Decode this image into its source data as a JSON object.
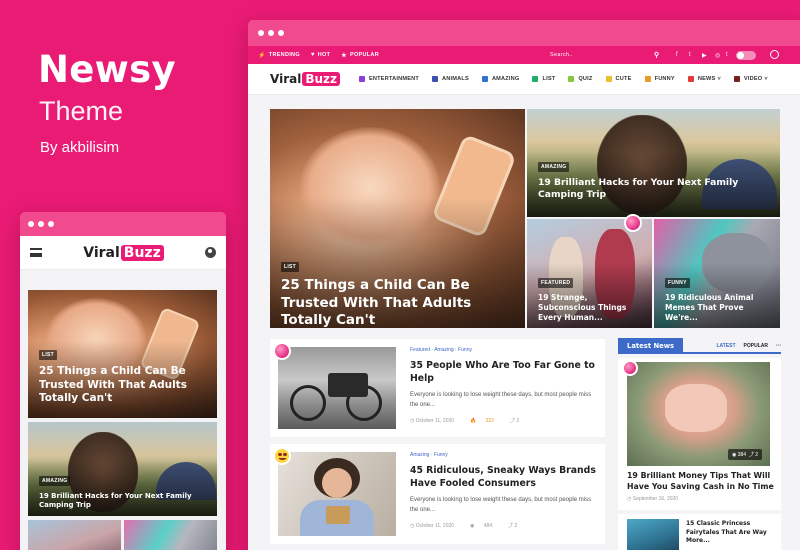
{
  "promo": {
    "title": "Newsy",
    "subtitle": "Theme",
    "author": "By akbilisim"
  },
  "brand": {
    "logo_left": "Viral",
    "logo_right": "Buzz",
    "accent": "#ea1b75",
    "blue": "#3d6ac8"
  },
  "mobile": {
    "hero": {
      "tag": "LIST",
      "title": "25 Things a Child Can Be Trusted With That Adults Totally Can't"
    },
    "second": {
      "tag": "AMAZING",
      "title": "19 Brilliant Hacks for Your Next Family Camping Trip"
    }
  },
  "topbar": {
    "items": [
      {
        "icon": "lightning-icon",
        "glyph": "⚡",
        "label": "TRENDING"
      },
      {
        "icon": "heart-icon",
        "glyph": "♥",
        "label": "HOT"
      },
      {
        "icon": "star-icon",
        "glyph": "★",
        "label": "POPULAR"
      }
    ],
    "search_placeholder": "Search..",
    "social": [
      {
        "name": "facebook-icon",
        "glyph": "f"
      },
      {
        "name": "twitter-icon",
        "glyph": "t"
      },
      {
        "name": "youtube-icon",
        "glyph": "▶"
      },
      {
        "name": "instagram-icon",
        "glyph": "◎"
      },
      {
        "name": "tumblr-icon",
        "glyph": "t"
      }
    ]
  },
  "nav": {
    "items": [
      {
        "label": "ENTERTAINMENT",
        "color": "#8a3fd6"
      },
      {
        "label": "ANIMALS",
        "color": "#3d4fb0"
      },
      {
        "label": "AMAZING",
        "color": "#2f6fd6"
      },
      {
        "label": "LIST",
        "color": "#1fae6a"
      },
      {
        "label": "QUIZ",
        "color": "#86c83a"
      },
      {
        "label": "CUTE",
        "color": "#e8c12a"
      },
      {
        "label": "FUNNY",
        "color": "#e99a26"
      },
      {
        "label": "NEWS",
        "color": "#e23a3a",
        "dropdown": "˅"
      },
      {
        "label": "VIDEO",
        "color": "#7a1d1d",
        "dropdown": "˅"
      }
    ]
  },
  "featured": {
    "main": {
      "tag": "LIST",
      "title": "25 Things a Child Can Be Trusted With That Adults Totally Can't"
    },
    "top_right": {
      "tag": "AMAZING",
      "title": "19 Brilliant Hacks for Your Next Family Camping Trip"
    },
    "bottom_left": {
      "tag": "FEATURED",
      "title": "19 Strange, Subconscious Things Every Human..."
    },
    "bottom_right": {
      "tag": "FUNNY",
      "title": "19 Ridiculous Animal Memes That Prove We're..."
    }
  },
  "posts": [
    {
      "cats": [
        "Featured",
        "Amazing",
        "Funny"
      ],
      "title": "35 People Who Are Too Far Gone to Help",
      "excerpt": "Everyone is looking to lose weight these days, but most people miss the one...",
      "date": "October 11, 2020",
      "stat_icon": "fire-icon",
      "stat_glyph": "🔥",
      "stat": "322",
      "share": "2"
    },
    {
      "cats": [
        "Amazing",
        "Funny"
      ],
      "title": "45 Ridiculous, Sneaky Ways Brands Have Fooled Consumers",
      "excerpt": "Everyone is looking to lose weight these days, but most people miss the one...",
      "date": "October 11, 2020",
      "stat_icon": "eye-icon",
      "stat_glyph": "◉",
      "stat": "484",
      "share": "2"
    }
  ],
  "sidebar": {
    "title": "Latest News",
    "tabs": [
      "LATEST",
      "POPULAR"
    ],
    "more": "···",
    "card": {
      "title": "19 Brilliant Money Tips That Will Have You Saving Cash in No Time",
      "date": "September 16, 2020",
      "views": "384",
      "share": "2"
    },
    "second": {
      "title": "15 Classic Princess Fairytales That Are Way More..."
    }
  }
}
